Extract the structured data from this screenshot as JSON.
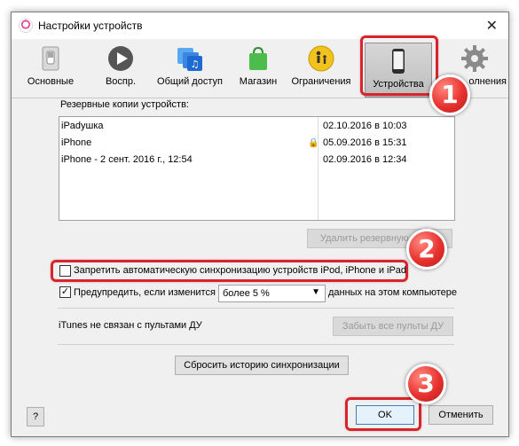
{
  "window": {
    "title": "Настройки устройств"
  },
  "toolbar": {
    "tabs": [
      {
        "label": "Основные",
        "icon": "switch-icon"
      },
      {
        "label": "Воспр.",
        "icon": "play-icon"
      },
      {
        "label": "Общий доступ",
        "icon": "shared-music-icon"
      },
      {
        "label": "Магазин",
        "icon": "store-bag-icon"
      },
      {
        "label": "Ограничения",
        "icon": "parental-icon"
      },
      {
        "label": "Устройства",
        "icon": "phone-icon"
      },
      {
        "label": "олнения",
        "icon": "gear-icon"
      }
    ],
    "selected": "Устройства"
  },
  "backups": {
    "label": "Резервные копии устройств:",
    "rows": [
      {
        "name": "iPadушка",
        "date": "02.10.2016 в 10:03",
        "locked": false
      },
      {
        "name": "iPhone",
        "date": "05.09.2016 в 15:31",
        "locked": true
      },
      {
        "name": "iPhone - 2 сент. 2016 г., 12:54",
        "date": "02.09.2016 в 12:34",
        "locked": false
      }
    ],
    "delete_button": "Удалить резервную копию"
  },
  "options": {
    "prevent_sync_label": "Запретить автоматическую синхронизацию устройств iPod, iPhone и iPad",
    "prevent_sync_checked": false,
    "warn_label_before": "Предупредить, если изменится",
    "warn_select_value": "более 5 %",
    "warn_label_after": "данных на этом компьютере",
    "warn_checked": true
  },
  "remotes": {
    "status": "iTunes не связан с пультами ДУ",
    "forget_button": "Забыть все пульты ДУ"
  },
  "reset_sync_button": "Сбросить историю синхронизации",
  "footer": {
    "help": "?",
    "ok": "OK",
    "cancel": "Отменить"
  },
  "badges": [
    "1",
    "2",
    "3"
  ],
  "colors": {
    "highlight_red": "#d6262d",
    "badge_red": "#e8322f"
  }
}
